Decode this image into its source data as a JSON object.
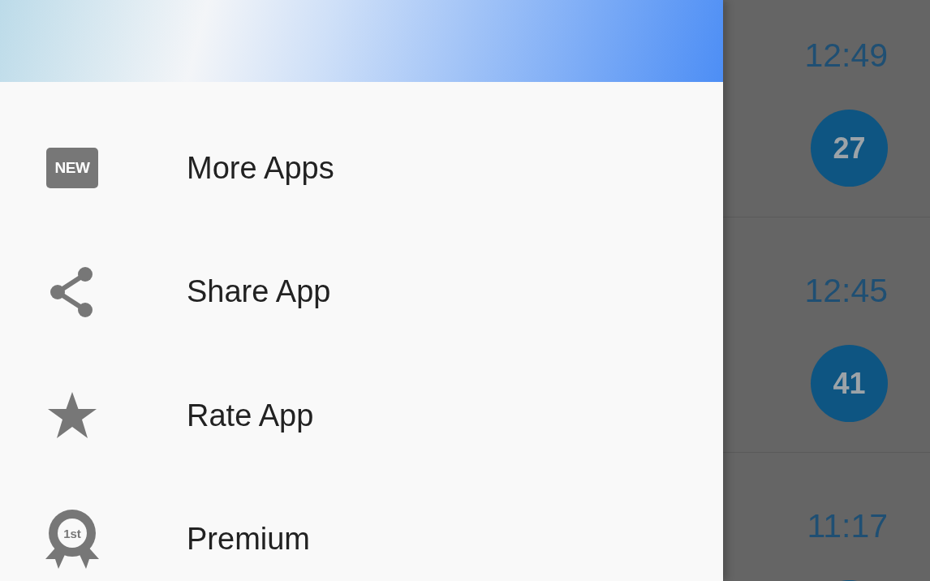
{
  "drawer": {
    "items": [
      {
        "label": "More Apps",
        "kind": "new",
        "icon_text": "NEW"
      },
      {
        "label": "Share App",
        "kind": "share"
      },
      {
        "label": "Rate App",
        "kind": "star"
      },
      {
        "label": "Premium",
        "kind": "award",
        "icon_text": "1st"
      }
    ]
  },
  "list": {
    "rows": [
      {
        "time": "12:49",
        "badge": "27"
      },
      {
        "time": "12:45",
        "badge": "41"
      },
      {
        "time": "11:17"
      }
    ]
  }
}
